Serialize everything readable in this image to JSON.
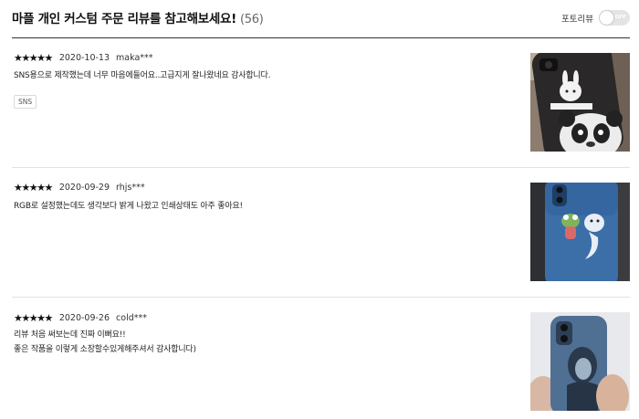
{
  "header": {
    "title": "마플 개인 커스텀 주문 리뷰를 참고해보세요!",
    "count": "(56)",
    "photo_review_label": "포토리뷰",
    "toggle_state": "OFF"
  },
  "reviews": [
    {
      "stars": "★★★★★",
      "date": "2020-10-13",
      "user": "maka***",
      "lines": [
        "SNS용으로 제작했는데 너무 마음에들어요..고급지게 잘나왔네요 감사합니다."
      ],
      "tag": "SNS",
      "photo_icon": "phone-case-panda-rabbit-photo"
    },
    {
      "stars": "★★★★★",
      "date": "2020-09-29",
      "user": "rhjs***",
      "lines": [
        "RGB로 설정했는데도 생각보다 밝게 나왔고 인쇄상태도 아주 좋아요!"
      ],
      "photo_icon": "phone-case-blue-characters-photo"
    },
    {
      "stars": "★★★★★",
      "date": "2020-09-26",
      "user": "cold***",
      "lines": [
        "리뷰 처음 써보는데 진짜 이뻐요!!",
        "좋은 작품을 이렇게 소장할수있게해주셔서 감사합니다)"
      ],
      "photo_icon": "phone-case-portrait-photo"
    }
  ]
}
